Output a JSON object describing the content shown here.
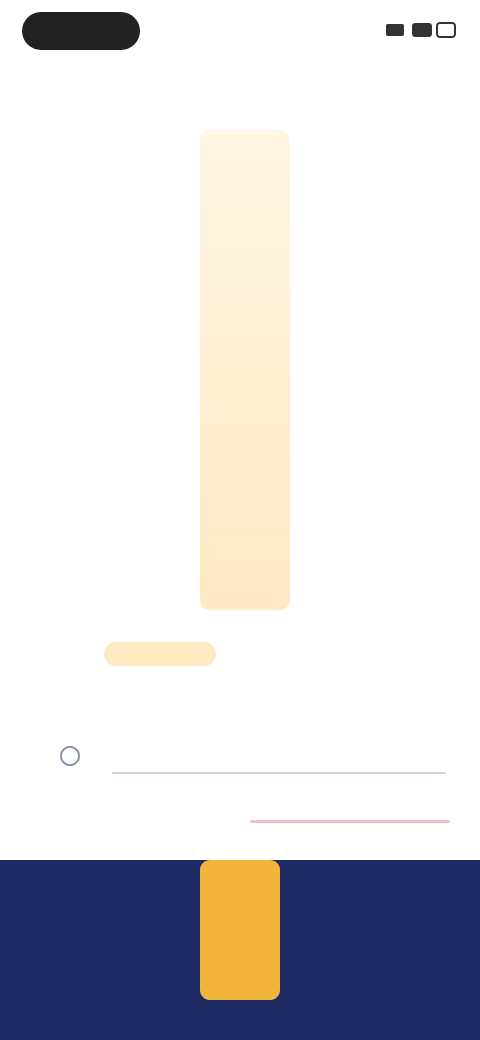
{
  "status_bar": {
    "pill_text": "",
    "icons": [
      "signal-icon",
      "wifi-icon",
      "battery-icon"
    ]
  },
  "header": {
    "title": ""
  },
  "left_panel": {
    "items": [
      "",
      "",
      "",
      "",
      "",
      "",
      "",
      "",
      "",
      "",
      ""
    ]
  },
  "tabs": {
    "items": [
      "",
      "",
      "",
      "",
      ""
    ],
    "active_index": 1
  },
  "section": {
    "title": "",
    "sub_label": ""
  },
  "search": {
    "placeholder": ""
  },
  "bottom_nav": {
    "row1": [
      "",
      "",
      "",
      "",
      ""
    ],
    "row2": [
      "",
      "",
      "",
      "",
      ""
    ],
    "center_button_label": ""
  },
  "colors": {
    "accent": "#f2b43d",
    "nav_background": "#1d2a63",
    "highlight_column": "#ffe8c2"
  }
}
